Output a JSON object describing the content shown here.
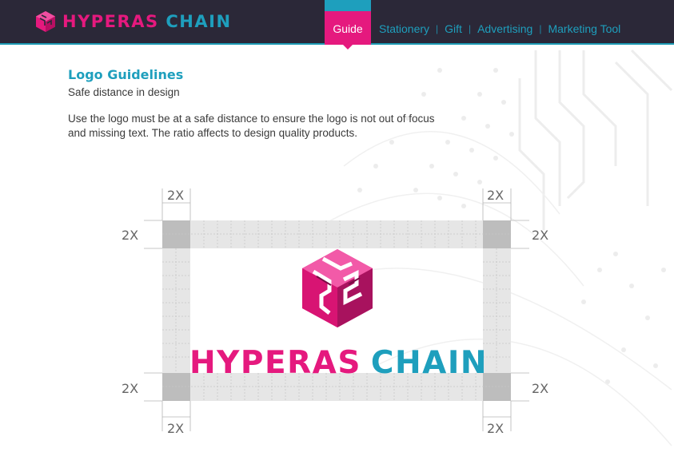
{
  "header": {
    "brand_word1": "HYPERAS",
    "brand_word2": "CHAIN",
    "nav": [
      {
        "label": "Guide",
        "active": true
      },
      {
        "label": "Stationery"
      },
      {
        "label": "Gift"
      },
      {
        "label": "Advertising"
      },
      {
        "label": "Marketing Tool"
      }
    ],
    "separator": "|"
  },
  "content": {
    "title": "Logo Guidelines",
    "subtitle": "Safe distance in design",
    "body": "Use the logo must be at a safe distance to ensure the logo is not out of focus and missing text. The ratio affects to design quality products."
  },
  "diagram": {
    "unit_label": "2X",
    "logo_word1": "HYPERAS",
    "logo_word2": "CHAIN"
  },
  "colors": {
    "magenta": "#e5197e",
    "cyan": "#1e9fbd",
    "header_bg": "#2b2838",
    "zone_light": "#e6e6e6",
    "zone_dark": "#bdbdbd"
  }
}
